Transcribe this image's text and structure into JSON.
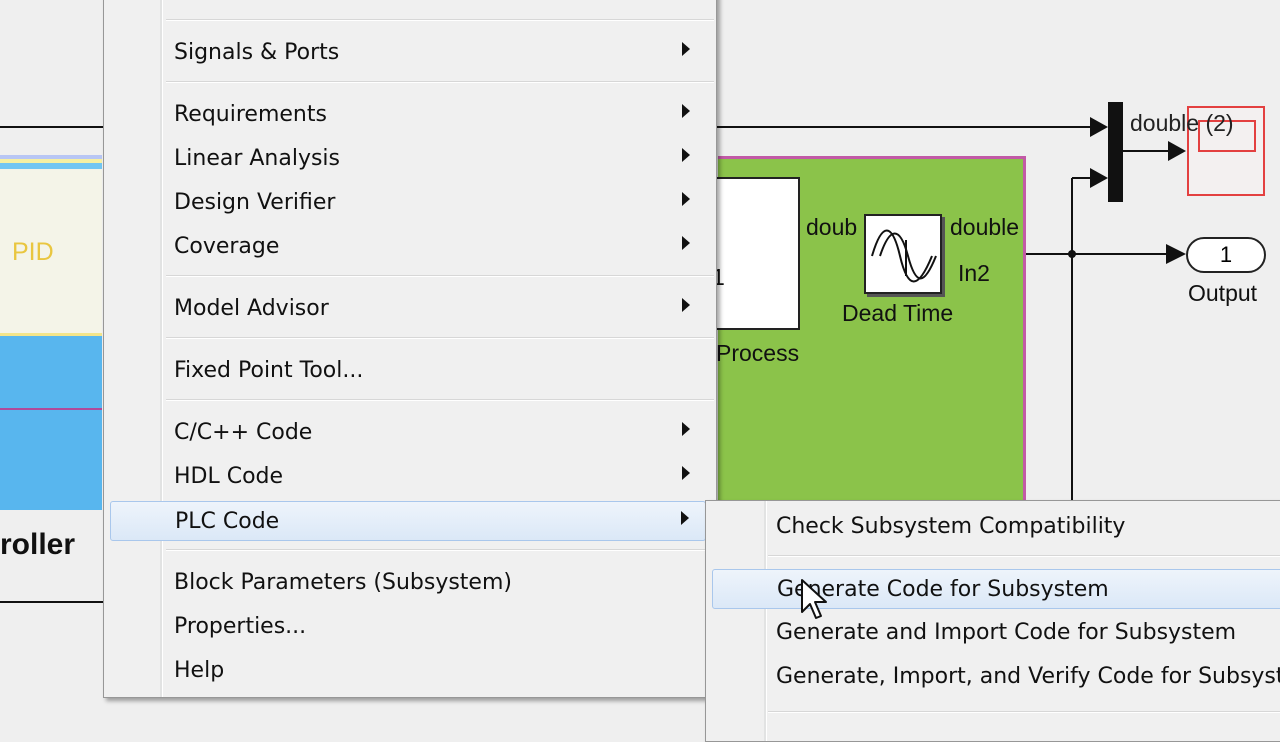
{
  "canvas": {
    "pid_label": "PID",
    "controller_label": "roller",
    "process_label": "Process",
    "port_number_left": "1",
    "dead_time_label": "Dead Time",
    "signal_doub": "doub",
    "signal_double": "double",
    "in2_label": "In2",
    "mux_signal": "double (2)",
    "output_port_number": "1",
    "output_label": "Output"
  },
  "context_menu": {
    "items": [
      {
        "label": "Signals & Ports",
        "submenu": true
      },
      {
        "label": "Requirements",
        "submenu": true
      },
      {
        "label": "Linear Analysis",
        "submenu": true
      },
      {
        "label": "Design Verifier",
        "submenu": true
      },
      {
        "label": "Coverage",
        "submenu": true
      },
      {
        "label": "Model Advisor",
        "submenu": true
      },
      {
        "label": "Fixed Point Tool...",
        "submenu": false
      },
      {
        "label": "C/C++ Code",
        "submenu": true
      },
      {
        "label": "HDL Code",
        "submenu": true
      },
      {
        "label": "PLC Code",
        "submenu": true,
        "highlighted": true
      },
      {
        "label": "Block Parameters (Subsystem)",
        "submenu": false
      },
      {
        "label": "Properties...",
        "submenu": false
      },
      {
        "label": "Help",
        "submenu": false
      }
    ]
  },
  "plc_submenu": {
    "items": [
      {
        "label": "Check Subsystem Compatibility"
      },
      {
        "label": "Generate Code for Subsystem",
        "highlighted": true
      },
      {
        "label": "Generate and Import Code for Subsystem"
      },
      {
        "label": "Generate, Import, and Verify Code for Subsystem"
      }
    ]
  },
  "colors": {
    "subsystem_green": "#8bc34a",
    "pid_blue": "#58b6ee",
    "menu_bg": "#f0f0f0",
    "highlight_border": "#a9c7ec"
  }
}
